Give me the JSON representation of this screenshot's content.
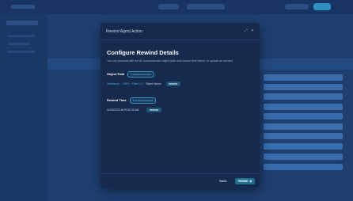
{
  "modal": {
    "title": "Rewind Agent Action",
    "expand_icon": "expand-icon",
    "close_icon": "close-icon",
    "heading": "Configure Rewind Details",
    "description": "You can proceed with the AI-recommended object path and rewind time below, or update as needed.",
    "object_path": {
      "label": "Object Path",
      "badge": "AI Recommended",
      "breadcrumb": [
        "Salesforce",
        "ODS",
        "Field 1.2",
        "Object Name"
      ],
      "update_label": "UPDATE"
    },
    "rewind_time": {
      "label": "Rewind Time",
      "badge": "AI Recommended",
      "value": "11/03/2022 at 09:52:22 AM",
      "update_label": "UPDATE"
    },
    "footer": {
      "back_label": "BACK",
      "rewind_label": "REWIND"
    }
  }
}
